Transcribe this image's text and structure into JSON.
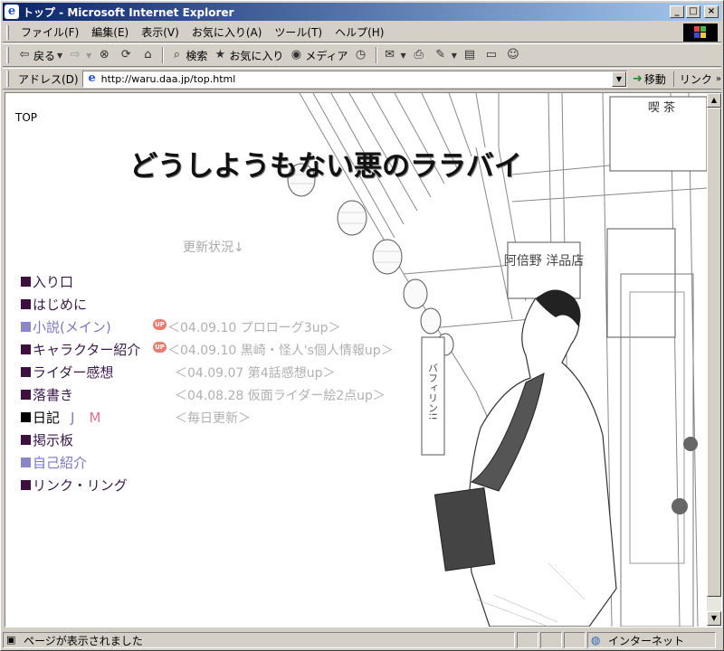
{
  "window": {
    "title": "トップ - Microsoft Internet Explorer",
    "controls": [
      "_",
      "□",
      "×"
    ]
  },
  "menu": [
    "ファイル(F)",
    "編集(E)",
    "表示(V)",
    "お気に入り(A)",
    "ツール(T)",
    "ヘルプ(H)"
  ],
  "toolbar": {
    "back": "戻る",
    "search": "検索",
    "favorites": "お気に入り",
    "media": "メディア"
  },
  "address": {
    "label": "アドレス(D)",
    "url": "http://waru.daa.jp/top.html",
    "go": "移動",
    "links": "リンク"
  },
  "page": {
    "label": "TOP",
    "title": "どうしようもない悪のララバイ",
    "update_heading": "更新状況↓",
    "nav": [
      {
        "label": "入り口",
        "square": "#3d1040",
        "style": "dark"
      },
      {
        "label": "はじめに",
        "square": "#3d1040",
        "style": "dark"
      },
      {
        "label": "小説(メイン)",
        "square": "#8a86c8",
        "style": "light",
        "badge": "UP",
        "update": "＜04.09.10 プロローグ3up＞"
      },
      {
        "label": "キャラクター紹介",
        "square": "#3d1040",
        "style": "dark",
        "badge": "UP",
        "update": "＜04.09.10 黒崎・怪人's個人情報up＞"
      },
      {
        "label": "ライダー感想",
        "square": "#3d1040",
        "style": "dark",
        "update": "＜04.09.07 第4話感想up＞"
      },
      {
        "label": "落書き",
        "square": "#3d1040",
        "style": "dark",
        "update": "＜04.08.28 仮面ライダー絵2点up＞"
      },
      {
        "label": "日記",
        "square": "#000000",
        "style": "black",
        "extra1": "J",
        "extra2": "M",
        "update": "＜毎日更新＞"
      },
      {
        "label": "掲示板",
        "square": "#3d1040",
        "style": "dark"
      },
      {
        "label": "自己紹介",
        "square": "#8a86c8",
        "style": "light"
      },
      {
        "label": "リンク・リング",
        "square": "#3d1040",
        "style": "dark"
      }
    ],
    "illustration_signs": {
      "cafe": "喫 茶",
      "shop": "阿倍野 洋品店",
      "vertical": "バフィリン!!"
    }
  },
  "status": {
    "text": "ページが表示されました",
    "zone": "インターネット"
  }
}
